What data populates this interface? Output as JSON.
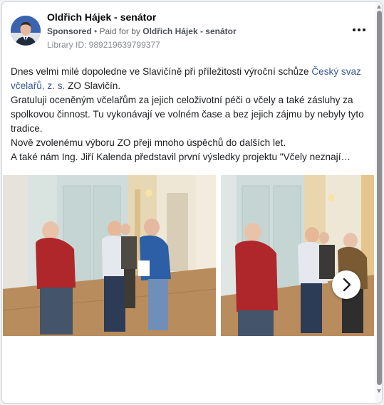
{
  "post": {
    "author": "Oldřich Hájek - senátor",
    "sponsored": "Sponsored",
    "separator": " • ",
    "paid_prefix": "Paid for by ",
    "paid_by": "Oldřich Hájek - senátor",
    "library_id": "Library ID: 989219639799377",
    "text": {
      "p1_before": "Dnes velmi milé dopoledne ve Slavičíně při příležitosti výroční schůze ",
      "p1_link": "Český svaz včelařů, z. s.",
      "p1_after": " ZO Slavičín.",
      "p2": "Gratuluji oceněným včelařům za jejich celoživotní péči o včely a také zásluhy za spolkovou činnost. Tu vykonávají ve volném čase a bez jejich zájmu by nebyly tyto tradice.",
      "p3": "Nově zvolenému výboru ZO přeji mnoho úspěchů do dalších let.",
      "p4": "A také nám Ing. Jiří Kalenda představil první výsledky projektu \"Včely neznají…"
    }
  },
  "icons": {
    "more": "more-options-icon",
    "next": "chevron-right-icon"
  },
  "colors": {
    "link": "#385898",
    "text": "#1c1e21",
    "muted": "#65676b"
  }
}
